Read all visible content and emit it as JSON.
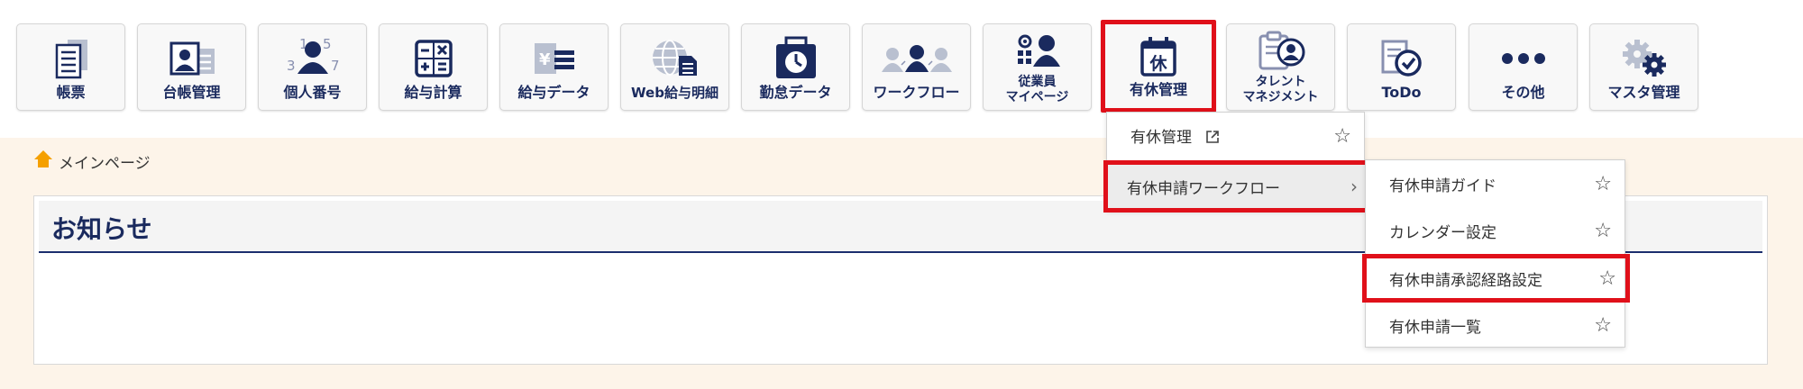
{
  "toolbar": {
    "items": [
      {
        "label": "帳票",
        "icon": "document-stack-icon"
      },
      {
        "label": "台帳管理",
        "icon": "ledger-card-icon"
      },
      {
        "label": "個人番号",
        "icon": "person-number-icon"
      },
      {
        "label": "給与計算",
        "icon": "calculator-icon"
      },
      {
        "label": "給与データ",
        "icon": "yen-data-icon"
      },
      {
        "label": "Web給与明細",
        "icon": "web-globe-document-icon"
      },
      {
        "label": "勤怠データ",
        "icon": "timecard-clock-icon"
      },
      {
        "label": "ワークフロー",
        "icon": "workflow-people-icon"
      },
      {
        "label": "従業員\nマイページ",
        "icon": "employee-mypage-icon"
      },
      {
        "label": "有休管理",
        "icon": "leave-calendar-icon",
        "calendar_glyph": "休"
      },
      {
        "label": "タレント\nマネジメント",
        "icon": "talent-clipboard-icon"
      },
      {
        "label": "ToDo",
        "icon": "todo-check-icon"
      },
      {
        "label": "その他",
        "icon": "more-dots-icon"
      },
      {
        "label": "マスタ管理",
        "icon": "gears-icon"
      }
    ]
  },
  "breadcrumb": {
    "icon": "home-icon",
    "label": "メインページ"
  },
  "notice": {
    "title": "お知らせ"
  },
  "leave_menu": {
    "items": [
      {
        "label": "有休管理",
        "icon": "external-link-icon",
        "star": "☆"
      },
      {
        "label": "有休申請ワークフロー",
        "chevron": "›"
      }
    ]
  },
  "workflow_submenu": {
    "items": [
      {
        "label": "有休申請ガイド",
        "star": "☆"
      },
      {
        "label": "カレンダー設定",
        "star": "☆"
      },
      {
        "label": "有休申請承認経路設定",
        "star": "☆"
      },
      {
        "label": "有休申請一覧",
        "star": "☆"
      }
    ]
  },
  "colors": {
    "navy": "#1a2a5e",
    "highlight_red": "#e0101a",
    "main_bg": "#fdf4e9",
    "home_orange": "#f5a000"
  }
}
